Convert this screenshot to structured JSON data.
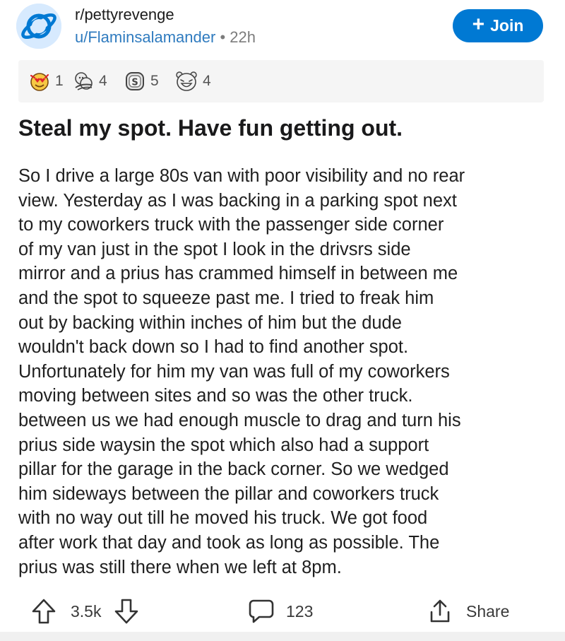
{
  "post": {
    "subreddit": "r/pettyrevenge",
    "author": "u/Flaminsalamander",
    "separator": "•",
    "age": "22h",
    "join_label": "Join",
    "join_plus": "+",
    "title": "Steal my spot. Have fun getting out.",
    "body_lines": [
      "So I drive a large 80s van with poor visibility and no rear",
      "view. Yesterday as I was backing in a parking spot next",
      "to my coworkers truck with the passenger side corner",
      "of my van just in the spot I look in the drivsrs side",
      "mirror and a prius has crammed himself in between me",
      "and the spot to squeeze past me.  I tried to freak him",
      "out by backing within inches of him but the dude",
      "wouldn't back down so I had to find another spot.",
      "Unfortunately for him my van was full of my coworkers",
      "moving between sites and so was the other truck.",
      "between us we had enough muscle to drag and turn his",
      "prius side waysin the spot which also had a support",
      "pillar for the garage in the back corner. So we wedged",
      "him sideways between the pillar and coworkers truck",
      "with no way out till he moved his truck. We got food",
      "after work  that day and took as long as possible. The",
      "prius was still there when we left at 8pm."
    ]
  },
  "awards": [
    {
      "icon": "heart-eyes-award-icon",
      "count": "1"
    },
    {
      "icon": "hug-award-icon",
      "count": "4"
    },
    {
      "icon": "silver-s-award-icon",
      "count": "5"
    },
    {
      "icon": "laughing-face-award-icon",
      "count": "4"
    }
  ],
  "actions": {
    "score": "3.5k",
    "comments": "123",
    "share_label": "Share"
  },
  "colors": {
    "accent": "#0079d3",
    "username": "#2f7bbf",
    "awards_bg": "#f5f5f5"
  }
}
